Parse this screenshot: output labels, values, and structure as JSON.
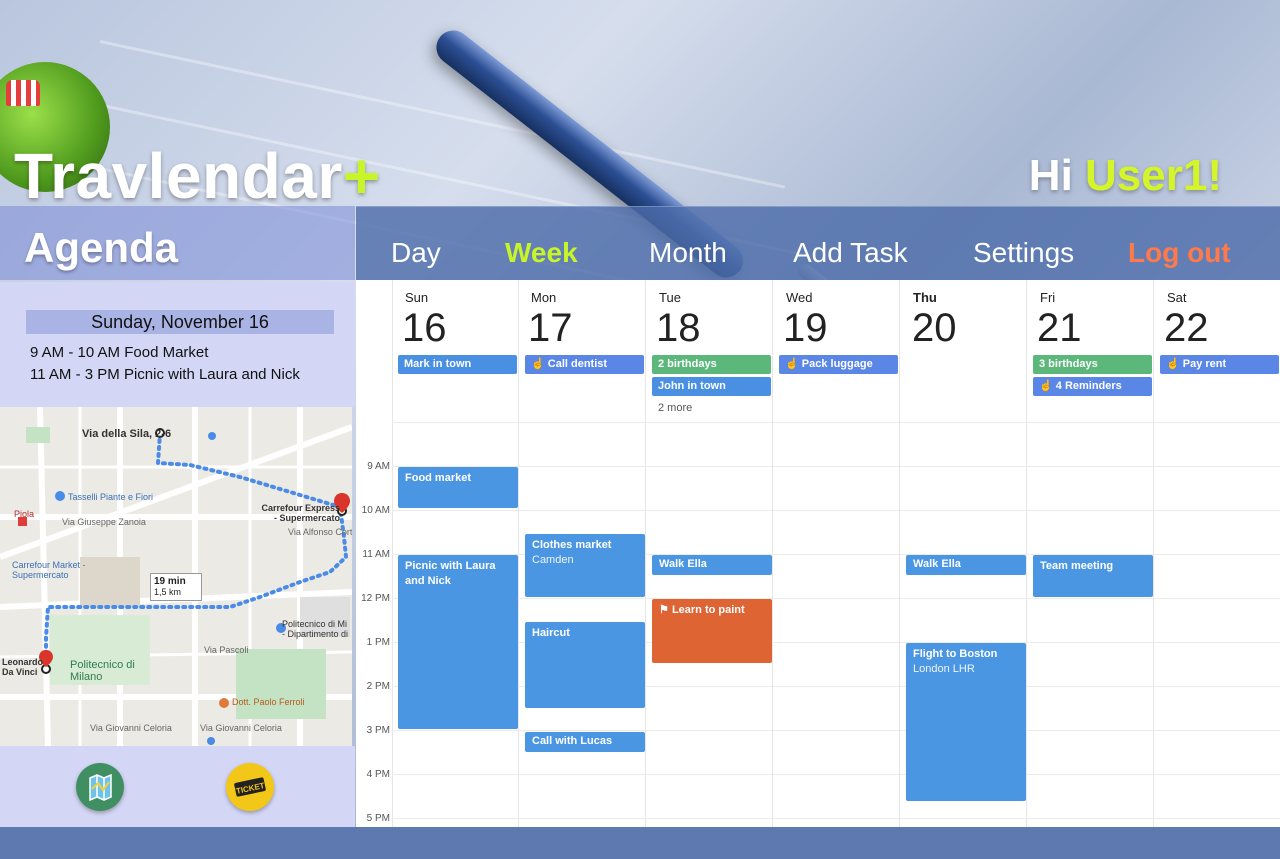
{
  "app": {
    "name": "Travlendar",
    "plus": "+"
  },
  "greeting": {
    "prefix": "Hi ",
    "user": "User1!"
  },
  "nav": {
    "day": "Day",
    "week": "Week",
    "month": "Month",
    "add_task": "Add Task",
    "settings": "Settings",
    "logout": "Log out",
    "active": "Week"
  },
  "agenda": {
    "title": "Agenda",
    "date": "Sunday, November  16",
    "events": [
      {
        "time": "9 AM - 10 AM",
        "title": "Food Market"
      },
      {
        "time": "11 AM - 3 PM",
        "title": "Picnic with Laura and Nick"
      }
    ]
  },
  "map": {
    "origin": "Via della Sila, 2-6",
    "poi1": "Tasselli Piante e Fiori",
    "dest": "Carrefour Express - Supermercato",
    "piola": "Piola",
    "carrefour2": "Carrefour Market - Supermercato",
    "walk_time": "19 min",
    "walk_dist": "1,5 km",
    "polimi_dept": "Politecnico di Mi - Dipartimento di",
    "leonardo": "Leonardo Da Vinci",
    "polimi": "Politecnico di Milano",
    "ferroli": "Dott. Paolo Ferroli",
    "street1": "Via Giuseppe Zanoia",
    "street2": "Via Alfonso Corti",
    "street3": "Via Pascoli",
    "street4": "Via Giovanni Celoria",
    "street5": "Via Giovanni Celoria"
  },
  "calendar": {
    "days": [
      {
        "name": "Sun",
        "num": "16"
      },
      {
        "name": "Mon",
        "num": "17"
      },
      {
        "name": "Tue",
        "num": "18"
      },
      {
        "name": "Wed",
        "num": "19"
      },
      {
        "name": "Thu",
        "num": "20"
      },
      {
        "name": "Fri",
        "num": "21"
      },
      {
        "name": "Sat",
        "num": "22"
      }
    ],
    "times": [
      "9 AM",
      "10 AM",
      "11 AM",
      "12 PM",
      "1 PM",
      "2 PM",
      "3 PM",
      "4 PM",
      "5 PM"
    ],
    "allday": {
      "sun": "Mark in town",
      "mon": "Call dentist",
      "tue1": "2 birthdays",
      "tue2": "John in town",
      "tue_more": "2 more",
      "wed": "Pack luggage",
      "fri1": "3 birthdays",
      "fri2": "4 Reminders",
      "sat": "Pay rent"
    },
    "events": {
      "food_market": "Food market",
      "picnic": "Picnic with Laura and Nick",
      "clothes_market": "Clothes market",
      "clothes_market_loc": "Camden",
      "haircut": "Haircut",
      "call_lucas": "Call with Lucas",
      "walk_ella_tue": "Walk Ella",
      "learn_paint": "Learn to paint",
      "walk_ella_thu": "Walk Ella",
      "flight": "Flight to Boston",
      "flight_loc": "London LHR",
      "team_meeting": "Team meeting"
    }
  },
  "colors": {
    "accent": "#c8f52a",
    "logout": "#ff7a4a",
    "event_blue": "#4a96e3",
    "event_green": "#5cb87a",
    "event_orange": "#de6434",
    "navbar": "#4d6daa"
  },
  "icons": {
    "map_button": "map-icon",
    "ticket_button": "ticket-icon"
  }
}
